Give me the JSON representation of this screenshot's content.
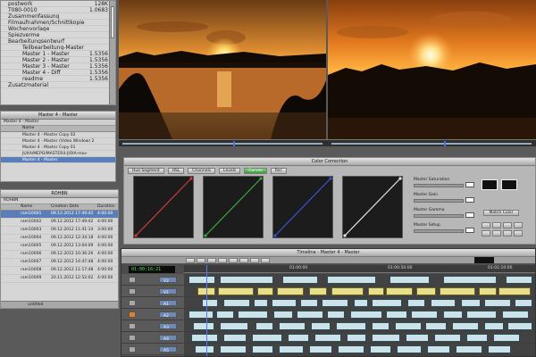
{
  "bin_tree": {
    "items": [
      {
        "label": "postwork",
        "size": "128K"
      },
      {
        "label": "T080-0010",
        "size": "1.0683"
      },
      {
        "label": "Zusammenfassung",
        "size": ""
      },
      {
        "label": "Filmaufnahmen/Schnittkopie",
        "size": ""
      },
      {
        "label": "Wochenvorlage",
        "size": ""
      },
      {
        "label": "Spiezverme",
        "size": ""
      },
      {
        "label": "Bearbeitungsentwurf",
        "size": ""
      },
      {
        "label": "Teilbearbeitung-Master",
        "size": ""
      },
      {
        "label": "Master 1 - Master",
        "size": "1.5356"
      },
      {
        "label": "Master 2 - Master",
        "size": "1.5356"
      },
      {
        "label": "Master 3 - Master",
        "size": "1.5356"
      },
      {
        "label": "Master 4 - Diff",
        "size": "1.5356"
      },
      {
        "label": "readme",
        "size": "1.5356"
      },
      {
        "label": "Zusatzmaterial",
        "size": ""
      }
    ]
  },
  "master_bin": {
    "title": "Master 4 - Master",
    "header": "Name",
    "items": [
      "Master 4 - Master Copy 02",
      "Master 4 - Master (Video Window) 2",
      "Master 4 - Master Copy 01",
      "JUXA/MEPO/MASTER4-JIOIA-mov",
      "Master 4 - Master"
    ],
    "selected_index": 4
  },
  "rawbin": {
    "title": "ROHBN",
    "columns": [
      "Name",
      "Creation Date",
      "Duration"
    ],
    "rows": [
      [
        "ram10001",
        "09.12.2012 17:49:42",
        "4:00:00"
      ],
      [
        "ram10002",
        "09.12.2012 17:49:42",
        "4:00:00"
      ],
      [
        "ram10003",
        "09.12.2012 11:41:14",
        "3:00:00"
      ],
      [
        "ram10004",
        "09.12.2012 12:34:18",
        "4:00:00"
      ],
      [
        "ram10005",
        "09.12.2012 13:04:09",
        "4:00:00"
      ],
      [
        "ram10006",
        "09.12.2012 10:36:26",
        "4:00:00"
      ],
      [
        "ram10007",
        "09.12.2012 14:47:48",
        "4:00:00"
      ],
      [
        "ram10008",
        "09.12.2012 11:17:48",
        "4:00:00"
      ],
      [
        "ram10009",
        "20.11.2012 12:52:02",
        "4:00:00"
      ]
    ],
    "footer": "untitled"
  },
  "color_correction": {
    "title": "Color Correction",
    "tabs": [
      "Hue Segment",
      "HSL",
      "Channels",
      "Levels",
      "Curves",
      "Rec"
    ],
    "active_tab": "Curves",
    "curve_colors": [
      "#d23a3a",
      "#3aa83a",
      "#3a55d2",
      "#e6e6e6"
    ],
    "sliders": [
      {
        "label": "Master Saturation",
        "value": "100"
      },
      {
        "label": "Master Gain",
        "value": "100"
      },
      {
        "label": "Master Gamma",
        "value": "100"
      },
      {
        "label": "Master Setup",
        "value": "0"
      }
    ],
    "right_buttons": [
      "Match Color",
      "Lift",
      "Gain"
    ]
  },
  "timeline": {
    "title": "Timeline - Master 4 - Master",
    "timecode": "01:00:16:21",
    "ruler_marks": [
      "01:00:00",
      "01:00:50:00",
      "01:01:10:00"
    ],
    "tracks": [
      "V2",
      "V1",
      "A1",
      "A2",
      "A3",
      "A4",
      "A5"
    ]
  },
  "colors": {
    "panel_bg": "#bdbdbd",
    "selection": "#5a7fb8",
    "timeline_bg": "#4c4c4c",
    "clip_video": "#cbe2e8",
    "clip_audio": "#e8df8a",
    "active_green": "#3a9a3a"
  }
}
